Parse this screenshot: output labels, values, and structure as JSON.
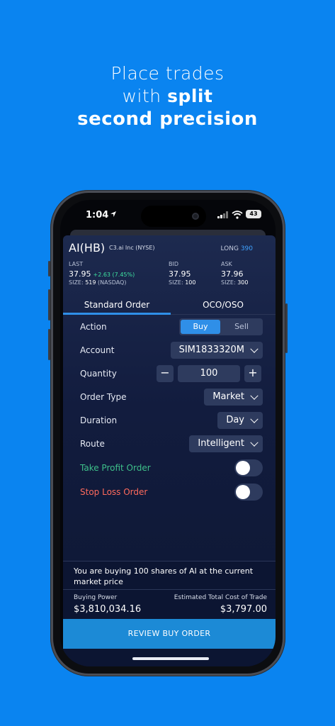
{
  "headline": {
    "line1": "Place trades",
    "line2_prefix": "with ",
    "line2_bold": "split",
    "line3": "second precision"
  },
  "status_bar": {
    "time": "1:04",
    "battery": "43"
  },
  "quote": {
    "symbol": "AI(HB)",
    "description": "C3.ai Inc (NYSE)",
    "position_label": "LONG",
    "position_value": "390",
    "last": {
      "label": "LAST",
      "value": "37.95",
      "change": "+2.63 (7.45%)",
      "size_label": "SIZE:",
      "size": "519",
      "exchange": "(NASDAQ)"
    },
    "bid": {
      "label": "BID",
      "value": "37.95",
      "size_label": "SIZE:",
      "size": "100"
    },
    "ask": {
      "label": "ASK",
      "value": "37.96",
      "size_label": "SIZE:",
      "size": "300"
    }
  },
  "tabs": [
    {
      "label": "Standard Order",
      "active": true
    },
    {
      "label": "OCO/OSO",
      "active": false
    }
  ],
  "form": {
    "action": {
      "label": "Action",
      "options": [
        "Buy",
        "Sell"
      ],
      "selected": "Buy"
    },
    "account": {
      "label": "Account",
      "value": "SIM1833320M"
    },
    "quantity": {
      "label": "Quantity",
      "value": "100",
      "minus": "−",
      "plus": "+"
    },
    "order_type": {
      "label": "Order Type",
      "value": "Market"
    },
    "duration": {
      "label": "Duration",
      "value": "Day"
    },
    "route": {
      "label": "Route",
      "value": "Intelligent"
    },
    "take_profit": {
      "label": "Take Profit Order",
      "on": false
    },
    "stop_loss": {
      "label": "Stop Loss Order",
      "on": false
    }
  },
  "summary": {
    "text": "You are buying 100 shares of AI at the current market price",
    "buying_power_label": "Buying Power",
    "buying_power": "$3,810,034.16",
    "est_cost_label": "Estimated Total Cost of Trade",
    "est_cost": "$3,797.00"
  },
  "review_button": "REVIEW BUY ORDER",
  "colors": {
    "background": "#0a84f0",
    "accent": "#2f8fe8",
    "take_profit": "#3ec08a",
    "stop_loss": "#ff6a5c"
  }
}
